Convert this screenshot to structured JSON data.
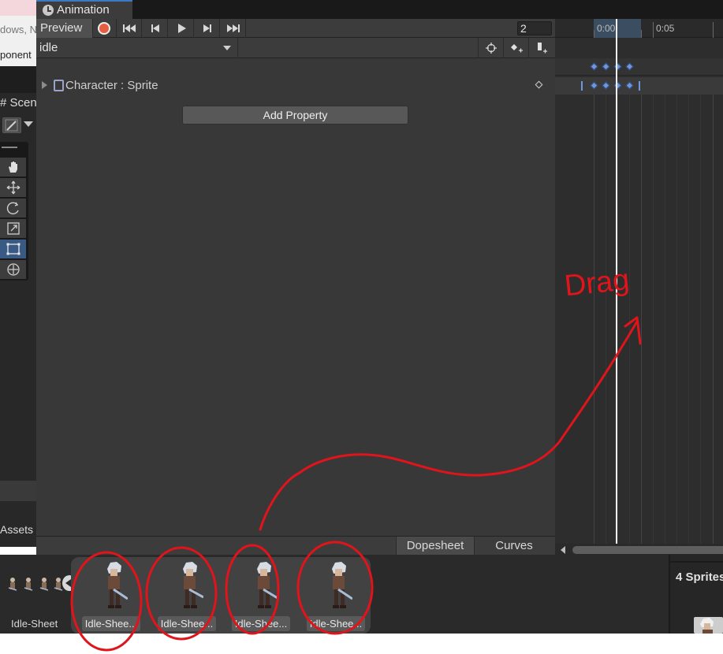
{
  "left_panels": {
    "snippet_1": "dows, N",
    "snippet_2": "ponent",
    "scene_tab": "# Scen",
    "tools": [
      "hand",
      "move",
      "rotate",
      "scale",
      "rect",
      "transform"
    ],
    "assets_label": "Assets"
  },
  "window": {
    "tab_title": "Animation"
  },
  "controls": {
    "preview_label": "Preview",
    "frame_value": "2"
  },
  "clip": {
    "selected": "idle"
  },
  "property": {
    "label": "Character : Sprite",
    "add_button": "Add Property"
  },
  "bottom_tabs": {
    "dopesheet": "Dopesheet",
    "curves": "Curves"
  },
  "timeline": {
    "labels": [
      "0:00",
      "0:05"
    ]
  },
  "project": {
    "sheet_name": "Idle-Sheet",
    "sprites": [
      {
        "label": "Idle-Shee..."
      },
      {
        "label": "Idle-Shee..."
      },
      {
        "label": "Idle-Shee..."
      },
      {
        "label": "Idle-Shee..."
      }
    ],
    "right_count": "4",
    "right_label": "Sprites"
  },
  "annotation": {
    "text": "Drag",
    "color": "#e0141b"
  }
}
